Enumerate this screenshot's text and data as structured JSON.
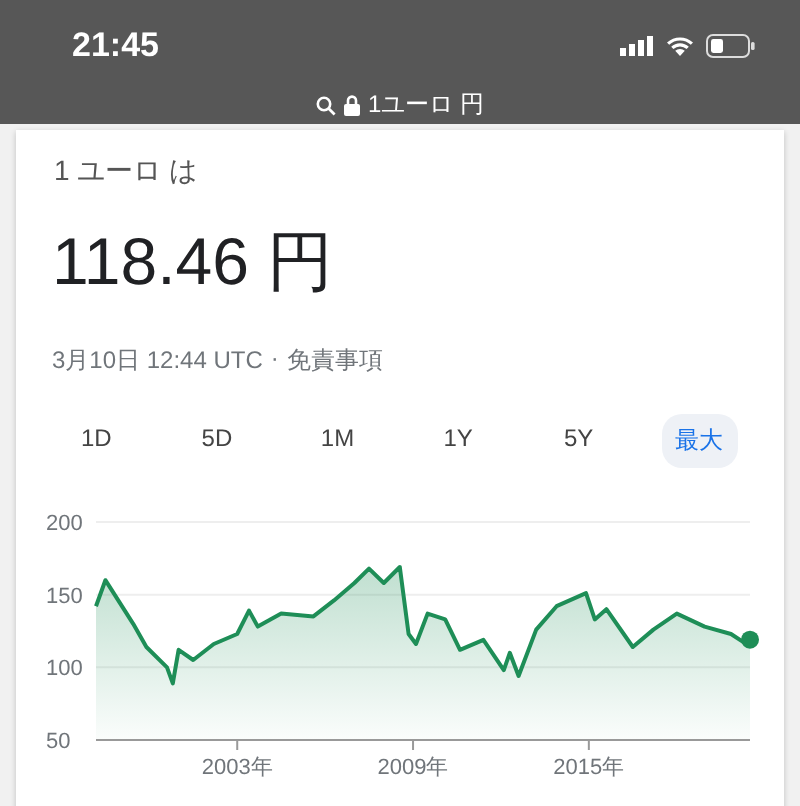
{
  "status_bar": {
    "time": "21:45"
  },
  "address_bar": {
    "text": "1ユーロ 円"
  },
  "converter": {
    "heading": "1 ユーロ は",
    "value": "118.46 円",
    "timestamp": "3月10日 12:44 UTC",
    "separator": "·",
    "disclaimer": "免責事項"
  },
  "ranges": [
    {
      "label": "1D",
      "selected": false
    },
    {
      "label": "5D",
      "selected": false
    },
    {
      "label": "1M",
      "selected": false
    },
    {
      "label": "1Y",
      "selected": false
    },
    {
      "label": "5Y",
      "selected": false
    },
    {
      "label": "最大",
      "selected": true
    }
  ],
  "chart": {
    "chart_data": {
      "type": "area",
      "x": [
        1998.18,
        1998.5,
        1999.45,
        1999.9,
        2000.6,
        2000.8,
        2001.0,
        2001.5,
        2002.2,
        2003.0,
        2003.4,
        2003.7,
        2004.5,
        2005.6,
        2006.3,
        2007.0,
        2007.5,
        2008.0,
        2008.55,
        2008.85,
        2009.1,
        2009.5,
        2010.1,
        2010.6,
        2011.4,
        2012.1,
        2012.3,
        2012.6,
        2013.2,
        2013.9,
        2014.9,
        2015.2,
        2015.6,
        2016.5,
        2017.2,
        2018.0,
        2018.95,
        2019.85,
        2020.3,
        2020.5
      ],
      "series": [
        {
          "color": "#1e8e57",
          "values": [
            142,
            160,
            130,
            114,
            100,
            89,
            112,
            105,
            116,
            123,
            139,
            128,
            137,
            135,
            146,
            158,
            168,
            158,
            169,
            123,
            116,
            137,
            133,
            112,
            119,
            98,
            110,
            94,
            126,
            142,
            151,
            133,
            140,
            114,
            126,
            137,
            128,
            123,
            117,
            119
          ]
        }
      ],
      "xlim": [
        1998.18,
        2020.5
      ],
      "ylim": [
        50,
        200
      ],
      "yticks": [
        50,
        100,
        150,
        200
      ],
      "xticks": [
        {
          "value": 2003,
          "label": "2003年"
        },
        {
          "value": 2009,
          "label": "2009年"
        },
        {
          "value": 2015,
          "label": "2015年"
        }
      ]
    }
  }
}
